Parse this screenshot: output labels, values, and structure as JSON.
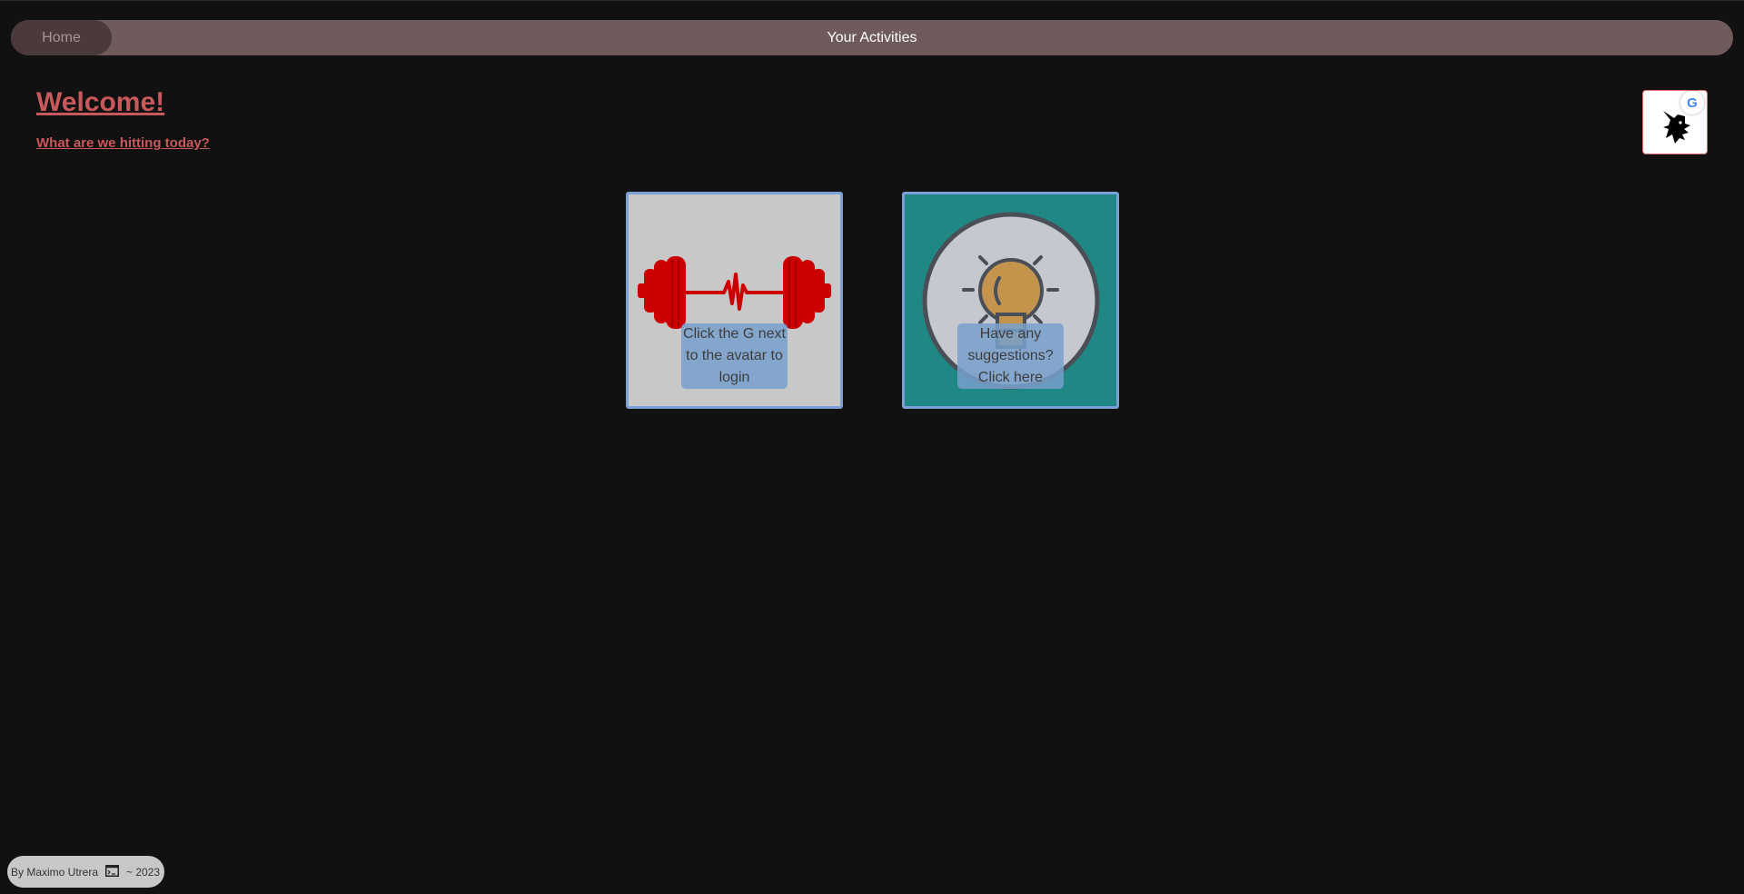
{
  "navbar": {
    "home_label": "Home",
    "title": "Your Activities"
  },
  "header": {
    "welcome": "Welcome!",
    "subtitle": "What are we hitting today?"
  },
  "auth": {
    "google_letter": "G"
  },
  "cards": [
    {
      "label": "Click the G next to the avatar to login",
      "icon": "dumbbell-heartbeat-icon",
      "background": "#c8c8c8"
    },
    {
      "label": "Have any suggestions? Click here",
      "icon": "lightbulb-icon",
      "background": "#1f8784"
    }
  ],
  "footer": {
    "author": "By Maximo Utrera",
    "year": "~ 2023"
  },
  "colors": {
    "accent": "#c7585c",
    "navbar": "#6f5b5b",
    "card_border": "#7aa0d6"
  }
}
